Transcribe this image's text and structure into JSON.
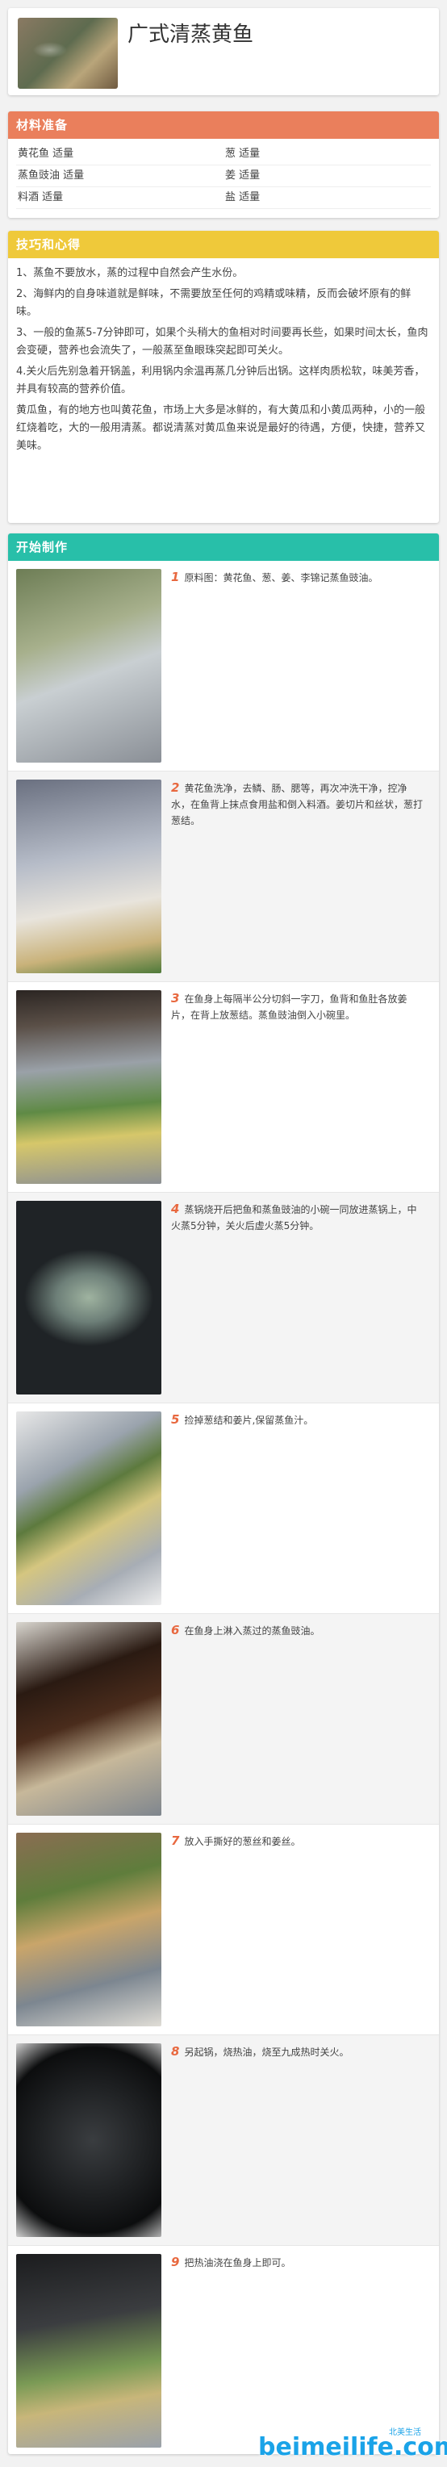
{
  "header": {
    "title": "广式清蒸黄鱼"
  },
  "ingredients": {
    "heading": "材料准备",
    "rows": [
      [
        "黄花鱼 适量",
        "葱 适量"
      ],
      [
        "蒸鱼豉油 适量",
        "姜 适量"
      ],
      [
        "料酒 适量",
        "盐 适量"
      ]
    ]
  },
  "tips": {
    "heading": "技巧和心得",
    "paragraphs": [
      "1、蒸鱼不要放水，蒸的过程中自然会产生水份。",
      "2、海鲜内的自身味道就是鲜味，不需要放至任何的鸡精或味精，反而会破坏原有的鲜味。",
      "3、一般的鱼蒸5-7分钟即可，如果个头稍大的鱼相对时间要再长些，如果时间太长，鱼肉会变硬，营养也会流失了，一般蒸至鱼眼珠突起即可关火。",
      "4.关火后先别急着开锅盖，利用锅内余温再蒸几分钟后出锅。这样肉质松软，味美芳香，并具有较高的营养价值。",
      "黄瓜鱼，有的地方也叫黄花鱼，市场上大多是冰鲜的，有大黄瓜和小黄瓜两种，小的一般红烧着吃，大的一般用清蒸。都说清蒸对黄瓜鱼来说是最好的待遇，方便，快捷，营养又美味。"
    ]
  },
  "steps": {
    "heading": "开始制作",
    "items": [
      {
        "num": "1",
        "text": "原料图：黄花鱼、葱、姜、李锦记蒸鱼豉油。"
      },
      {
        "num": "2",
        "text": "黄花鱼洗净，去鳞、肠、腮等，再次冲洗干净，控净水，在鱼背上抹点食用盐和倒入料酒。姜切片和丝状，葱打葱结。"
      },
      {
        "num": "3",
        "text": "在鱼身上每隔半公分切斜一字刀，鱼背和鱼肚各放姜片，在背上放葱结。蒸鱼豉油倒入小碗里。"
      },
      {
        "num": "4",
        "text": "蒸锅烧开后把鱼和蒸鱼豉油的小碗一同放进蒸锅上，中火蒸5分钟，关火后虚火蒸5分钟。"
      },
      {
        "num": "5",
        "text": "捡掉葱结和姜片,保留蒸鱼汁。"
      },
      {
        "num": "6",
        "text": "在鱼身上淋入蒸过的蒸鱼豉油。"
      },
      {
        "num": "7",
        "text": "放入手撕好的葱丝和姜丝。"
      },
      {
        "num": "8",
        "text": "另起锅，烧热油，烧至九成热时关火。"
      },
      {
        "num": "9",
        "text": "把热油浇在鱼身上即可。"
      }
    ]
  },
  "watermark": {
    "domain": "beimeilife.com",
    "cn": "北美生活"
  },
  "colors": {
    "ingredients": "#ea7f5c",
    "tips": "#efc93a",
    "steps": "#28bfa9",
    "step_number": "#e8683f"
  }
}
